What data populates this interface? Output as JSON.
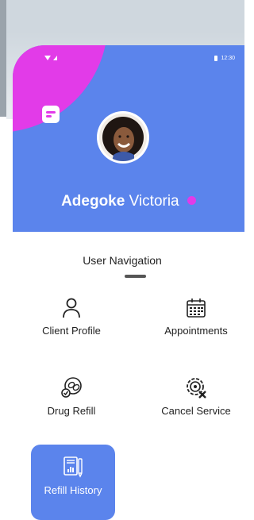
{
  "status_bar": {
    "time": "12:30"
  },
  "profile": {
    "first_name": "Adegoke",
    "last_name": "Victoria"
  },
  "section": {
    "title": "User Navigation"
  },
  "nav": {
    "client_profile": "Client Profile",
    "appointments": "Appointments",
    "drug_refill": "Drug Refill",
    "cancel_service": "Cancel Service",
    "refill_history": "Refill History"
  },
  "colors": {
    "primary": "#5b84ec",
    "accent": "#e23be8",
    "text": "#222222"
  },
  "icons": {
    "client_profile": "person-icon",
    "appointments": "calendar-icon",
    "drug_refill": "pills-icon",
    "cancel_service": "gear-cancel-icon",
    "refill_history": "report-icon"
  }
}
